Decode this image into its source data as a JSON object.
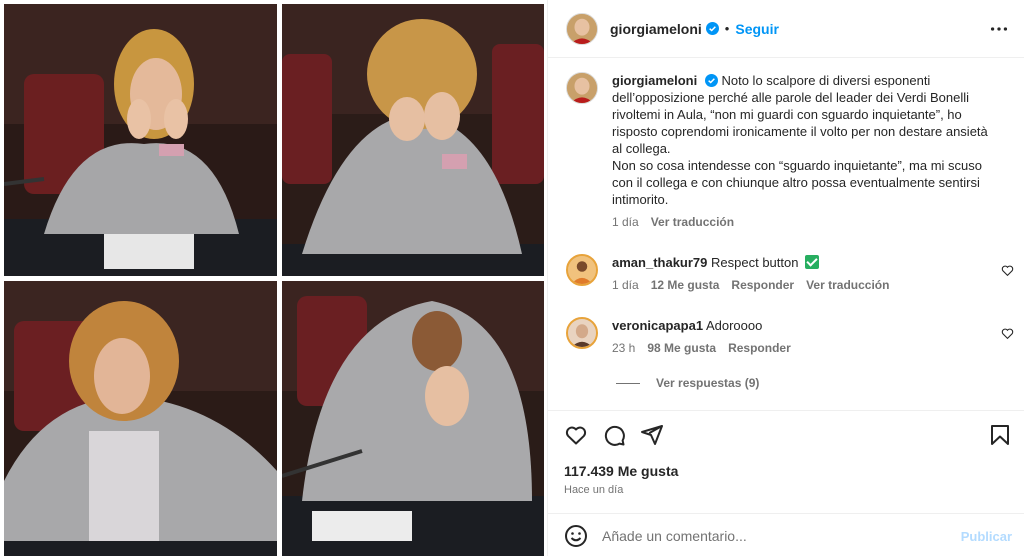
{
  "post": {
    "username": "giorgiameloni",
    "follow_label": "Seguir",
    "separator": "•"
  },
  "caption": {
    "username": "giorgiameloni",
    "text_p1": "Noto lo scalpore di diversi esponenti dell’opposizione perché alle parole del leader dei Verdi Bonelli rivoltemi in Aula, “non mi guardi con sguardo inquietante”, ho risposto coprendomi ironicamente il volto per non destare ansietà al collega.",
    "text_p2": "Non so cosa intendesse con “sguardo inquietante”, ma mi scuso con il collega e con chiunque altro possa eventualmente sentirsi intimorito.",
    "age": "1 día",
    "translate": "Ver traducción"
  },
  "comments": [
    {
      "username": "aman_thakur79",
      "text": "Respect button",
      "age": "1 día",
      "likes": "12 Me gusta",
      "reply": "Responder",
      "translate": "Ver traducción"
    },
    {
      "username": "veronicapapa1",
      "text": "Adoroooo",
      "age": "23 h",
      "likes": "98 Me gusta",
      "reply": "Responder"
    }
  ],
  "view_replies": "Ver respuestas (9)",
  "stats": {
    "likes": "117.439 Me gusta",
    "time": "Hace un día"
  },
  "composer": {
    "placeholder": "Añade un comentario...",
    "publish": "Publicar"
  },
  "colors": {
    "link_blue": "#0095f6",
    "verified_blue": "#0095f6",
    "muted": "#737373",
    "publish_disabled": "#b3dbff",
    "emoji_check": "#27ae60"
  },
  "icons": [
    "verified-badge-icon",
    "more-options-icon",
    "heart-icon",
    "comment-icon",
    "share-icon",
    "bookmark-icon",
    "emoji-icon"
  ]
}
